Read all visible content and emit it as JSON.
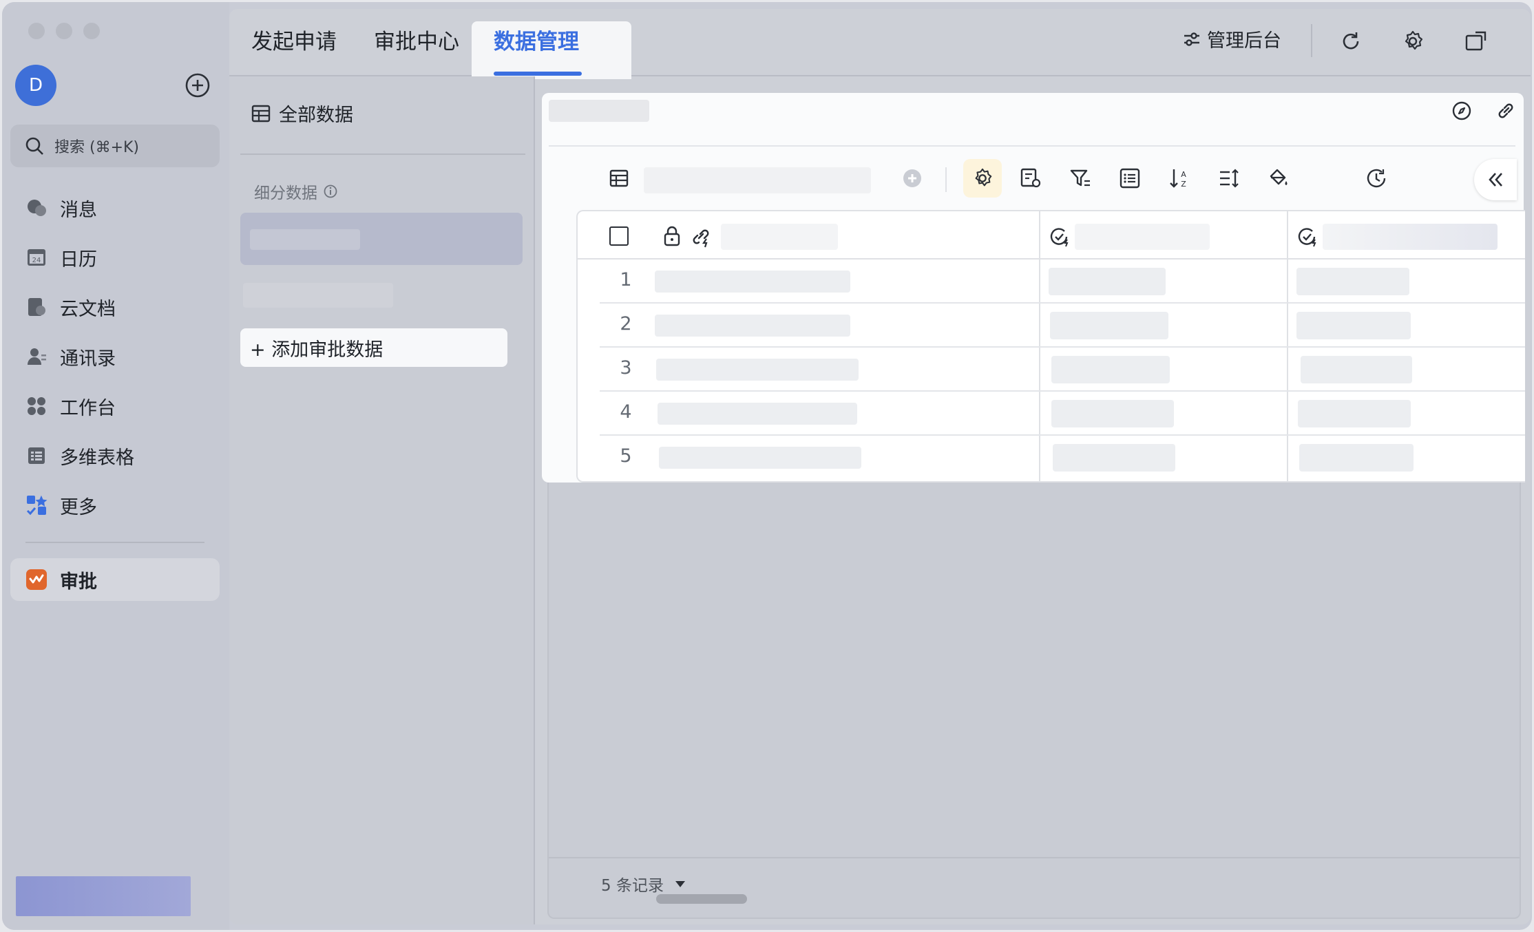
{
  "sidebar": {
    "avatar_letter": "D",
    "search_placeholder": "搜索 (⌘+K)",
    "items": [
      {
        "label": "消息",
        "icon": "chat-bubbles-icon"
      },
      {
        "label": "日历",
        "icon": "calendar-icon",
        "badge": "24"
      },
      {
        "label": "云文档",
        "icon": "cloud-doc-icon"
      },
      {
        "label": "通讯录",
        "icon": "contacts-icon"
      },
      {
        "label": "工作台",
        "icon": "workspace-grid-icon"
      },
      {
        "label": "多维表格",
        "icon": "base-table-icon"
      },
      {
        "label": "更多",
        "icon": "more-apps-icon"
      }
    ],
    "active_item": {
      "label": "审批",
      "icon": "approval-app-icon"
    }
  },
  "tabs": [
    {
      "label": "发起申请"
    },
    {
      "label": "审批中心"
    },
    {
      "label": "数据管理",
      "active": true
    }
  ],
  "header": {
    "admin_label": "管理后台"
  },
  "subpanel": {
    "title": "全部数据",
    "section_label": "细分数据",
    "add_label": "+ 添加审批数据"
  },
  "table": {
    "row_numbers": [
      "1",
      "2",
      "3",
      "4",
      "5"
    ],
    "record_count": "5 条记录"
  },
  "colors": {
    "accent": "#3b6fe0",
    "avatar": "#3e6fd8",
    "approval_icon": "#e0662c"
  }
}
